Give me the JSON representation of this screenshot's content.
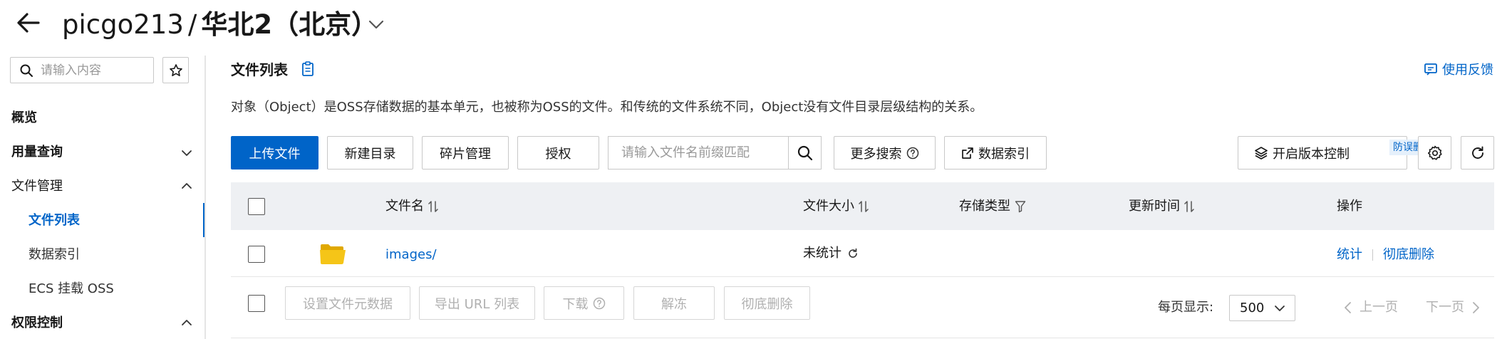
{
  "header": {
    "bucket_name": "picgo213",
    "separator": "/",
    "region": "华北2（北京）"
  },
  "sidebar": {
    "search_placeholder": "请输入内容",
    "items": [
      {
        "label": "概览"
      },
      {
        "label": "用量查询",
        "expanded": false
      },
      {
        "label": "文件管理",
        "expanded": true
      },
      {
        "label": "文件列表",
        "active": true
      },
      {
        "label": "数据索引"
      },
      {
        "label": "ECS 挂载 OSS"
      },
      {
        "label": "权限控制",
        "expanded": true
      }
    ]
  },
  "main": {
    "title": "文件列表",
    "feedback": "使用反馈",
    "description": "对象（Object）是OSS存储数据的基本单元，也被称为OSS的文件。和传统的文件系统不同，Object没有文件目录层级结构的关系。",
    "toolbar": {
      "upload": "上传文件",
      "new_dir": "新建目录",
      "fragments": "碎片管理",
      "authorize": "授权",
      "prefix_placeholder": "请输入文件名前缀匹配",
      "more_search": "更多搜索",
      "data_index": "数据索引",
      "versioning": "开启版本控制",
      "versioning_badge": "防误删"
    },
    "table": {
      "columns": [
        "文件名",
        "文件大小",
        "存储类型",
        "更新时间",
        "操作"
      ],
      "rows": [
        {
          "name": "images/",
          "size": "未统计",
          "storage_class": "",
          "updated": "",
          "actions": [
            "统计",
            "彻底删除"
          ]
        }
      ]
    },
    "bulk_actions": {
      "set_meta": "设置文件元数据",
      "export_urls": "导出 URL 列表",
      "download": "下载",
      "unfreeze": "解冻",
      "delete": "彻底删除"
    },
    "pagination": {
      "per_page_label": "每页显示:",
      "per_page": "500",
      "prev": "上一页",
      "next": "下一页"
    }
  },
  "colors": {
    "primary": "#0064c8",
    "header_bg": "#eef0f3",
    "folder": "#f5c518"
  }
}
